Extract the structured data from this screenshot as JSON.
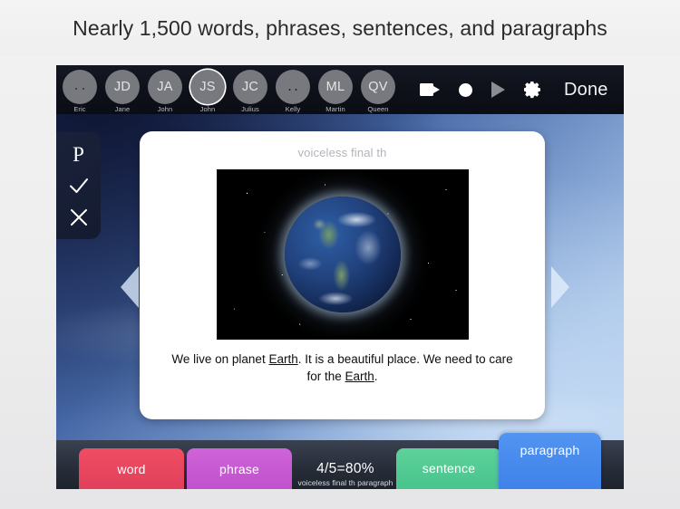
{
  "headline": "Nearly 1,500 words, phrases, sentences, and paragraphs",
  "toolbar": {
    "avatars": [
      {
        "initials": "",
        "name": "Eric",
        "type": "photo-eric",
        "selected": false
      },
      {
        "initials": "JD",
        "name": "Jane",
        "type": "initials",
        "selected": false
      },
      {
        "initials": "JA",
        "name": "John",
        "type": "initials",
        "selected": false
      },
      {
        "initials": "JS",
        "name": "John",
        "type": "initials",
        "selected": true
      },
      {
        "initials": "JC",
        "name": "Julius",
        "type": "initials",
        "selected": false
      },
      {
        "initials": "",
        "name": "Kelly",
        "type": "photo-kelly",
        "selected": false
      },
      {
        "initials": "ML",
        "name": "Martin",
        "type": "initials",
        "selected": false
      },
      {
        "initials": "QV",
        "name": "Queen",
        "type": "initials",
        "selected": false
      }
    ],
    "actions": {
      "video_icon": "video-camera-icon",
      "record_icon": "record-circle-icon",
      "play_icon": "play-triangle-icon",
      "settings_icon": "gear-icon",
      "done_label": "Done"
    }
  },
  "scorepad": {
    "prompt_label": "P",
    "correct_icon": "check-icon",
    "incorrect_icon": "x-icon"
  },
  "navigation": {
    "prev_icon": "left-arrow-icon",
    "next_icon": "right-arrow-icon"
  },
  "card": {
    "target_label": "voiceless final th",
    "image_alt": "earth-planet-image",
    "sentence_parts": [
      {
        "text": "We live on planet ",
        "underline": false
      },
      {
        "text": "Earth",
        "underline": true
      },
      {
        "text": ". It is a beautiful place. We need to care for the ",
        "underline": false
      },
      {
        "text": "Earth",
        "underline": true
      },
      {
        "text": ".",
        "underline": false
      }
    ]
  },
  "tabbar": {
    "tabs": [
      {
        "label": "word",
        "color": "#ef4d63",
        "active": false
      },
      {
        "label": "phrase",
        "color": "#cf63d8",
        "active": false
      },
      {
        "label": "sentence",
        "color": "#5ed29b",
        "active": false
      },
      {
        "label": "paragraph",
        "color": "#5294f0",
        "active": true
      }
    ],
    "score": {
      "percent": "4/5=80%",
      "detail": "voiceless final th paragraph"
    }
  }
}
